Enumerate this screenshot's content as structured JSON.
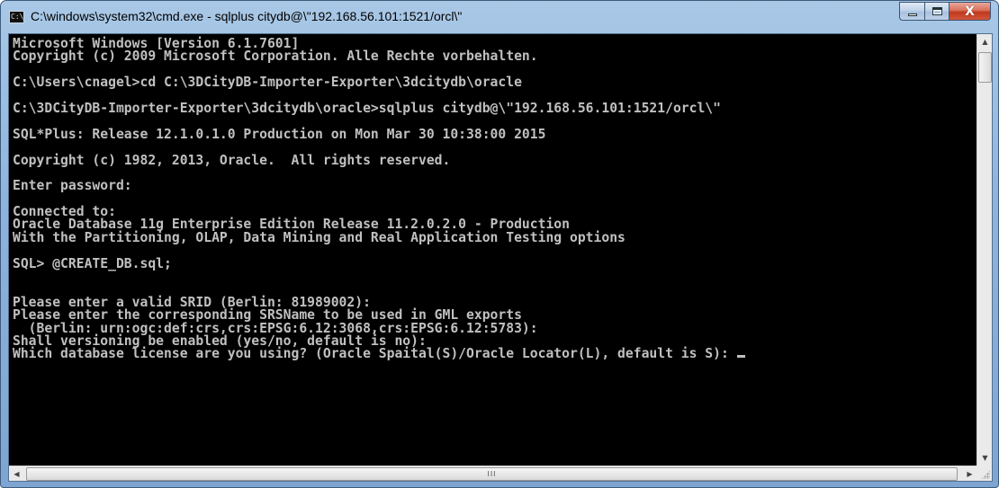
{
  "window": {
    "title": "C:\\windows\\system32\\cmd.exe - sqlplus  citydb@\\\"192.168.56.101:1521/orcl\\\"",
    "icon_label": "C:\\",
    "buttons": {
      "minimize": "minimize",
      "maximize": "maximize",
      "close": "X"
    }
  },
  "console": {
    "lines": [
      "Microsoft Windows [Version 6.1.7601]",
      "Copyright (c) 2009 Microsoft Corporation. Alle Rechte vorbehalten.",
      "",
      "C:\\Users\\cnagel>cd C:\\3DCityDB-Importer-Exporter\\3dcitydb\\oracle",
      "",
      "C:\\3DCityDB-Importer-Exporter\\3dcitydb\\oracle>sqlplus citydb@\\\"192.168.56.101:1521/orcl\\\"",
      "",
      "SQL*Plus: Release 12.1.0.1.0 Production on Mon Mar 30 10:38:00 2015",
      "",
      "Copyright (c) 1982, 2013, Oracle.  All rights reserved.",
      "",
      "Enter password:",
      "",
      "Connected to:",
      "Oracle Database 11g Enterprise Edition Release 11.2.0.2.0 - Production",
      "With the Partitioning, OLAP, Data Mining and Real Application Testing options",
      "",
      "SQL> @CREATE_DB.sql;",
      "",
      "",
      "Please enter a valid SRID (Berlin: 81989002):",
      "Please enter the corresponding SRSName to be used in GML exports",
      "  (Berlin: urn:ogc:def:crs,crs:EPSG:6.12:3068,crs:EPSG:6.12:5783):",
      "Shall versioning be enabled (yes/no, default is no):",
      "Which database license are you using? (Oracle Spaital(S)/Oracle Locator(L), default is S): "
    ]
  },
  "scrollbar": {
    "horizontal_thumb_label": "III",
    "up_arrow": "▲",
    "down_arrow": "▼",
    "left_arrow": "◀",
    "right_arrow": "▶"
  }
}
